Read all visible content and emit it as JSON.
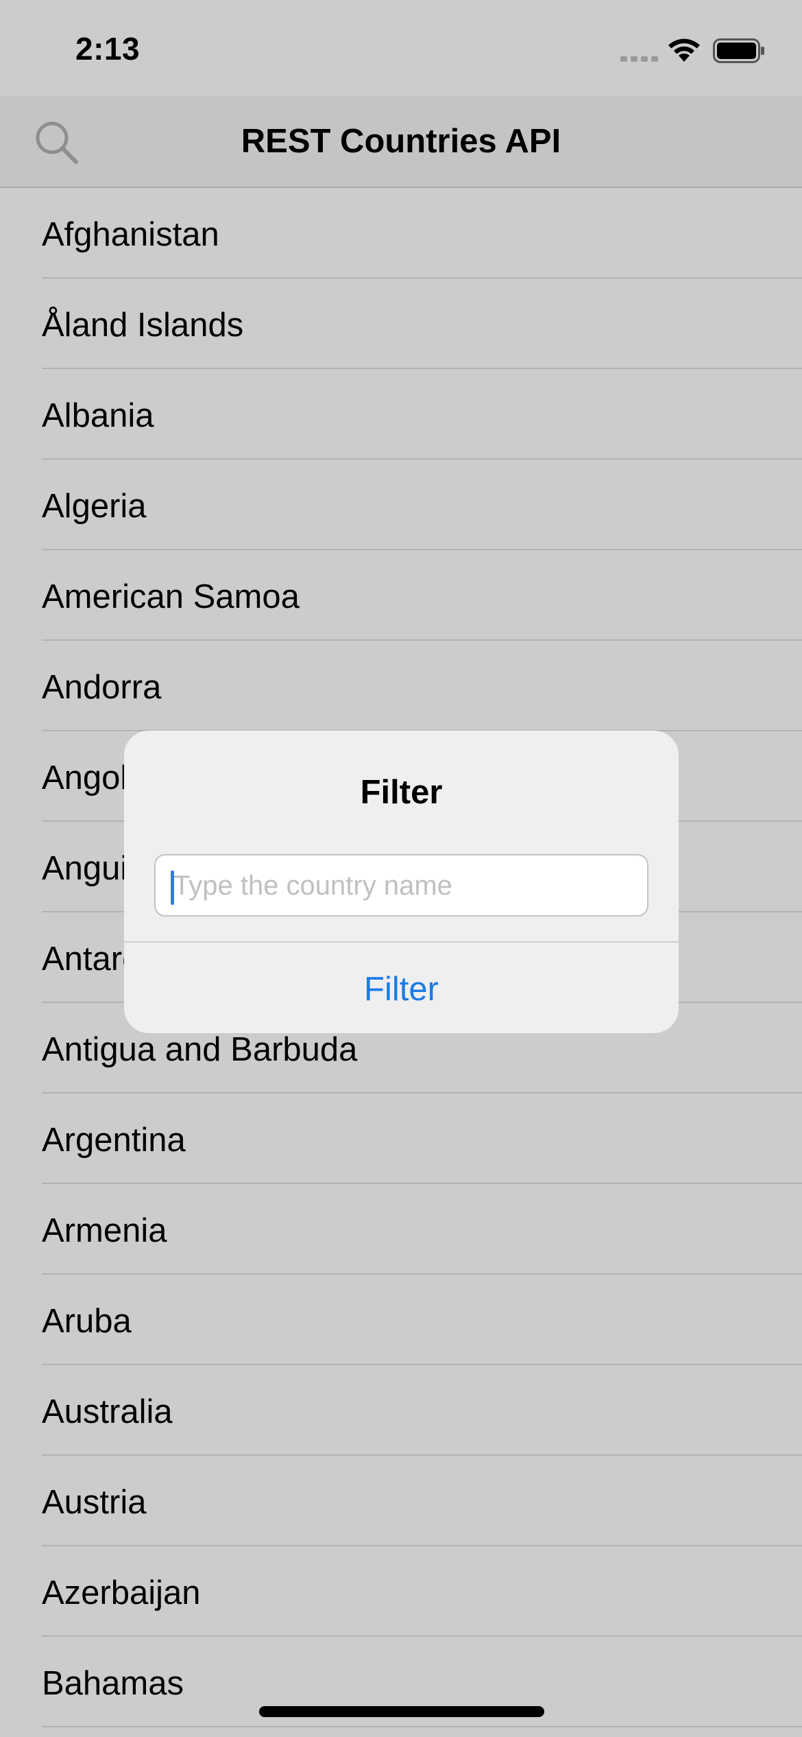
{
  "status_bar": {
    "time": "2:13",
    "icons": [
      "cellular-signal-icon",
      "wifi-icon",
      "battery-icon"
    ]
  },
  "nav": {
    "title": "REST Countries API",
    "left_icon": "search-icon"
  },
  "countries": [
    "Afghanistan",
    "Åland Islands",
    "Albania",
    "Algeria",
    "American Samoa",
    "Andorra",
    "Angola",
    "Anguilla",
    "Antarctica",
    "Antigua and Barbuda",
    "Argentina",
    "Armenia",
    "Aruba",
    "Australia",
    "Austria",
    "Azerbaijan",
    "Bahamas"
  ],
  "alert": {
    "title": "Filter",
    "input_placeholder": "Type the country name",
    "input_value": "",
    "action_label": "Filter"
  },
  "colors": {
    "dimmed_background": "#cccccc",
    "alert_background": "#efefef",
    "accent": "#1a7be8",
    "cursor": "#3478f6"
  }
}
